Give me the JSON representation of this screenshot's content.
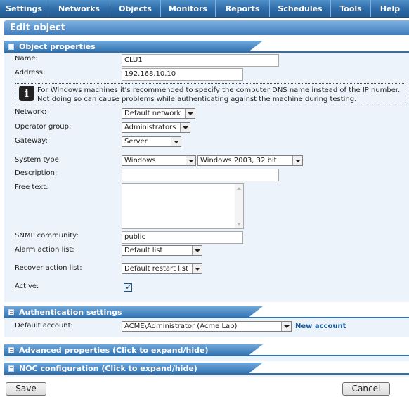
{
  "nav": {
    "items": [
      "Settings",
      "Networks",
      "Objects",
      "Monitors",
      "Reports",
      "Schedules",
      "Tools",
      "Help"
    ]
  },
  "page_title": "Edit object",
  "sections": {
    "object_properties": "Object properties",
    "authentication": "Authentication settings",
    "advanced": "Advanced properties (Click to expand/hide)",
    "noc": "NOC configuration (Click to expand/hide)"
  },
  "form": {
    "name_label": "Name:",
    "name_value": "CLU1",
    "address_label": "Address:",
    "address_value": "192.168.10.10",
    "info_text": "For Windows machines it's recommended to specify the computer DNS name instead of the IP number. Not doing so can cause problems while authenticating against the machine during testing.",
    "network_label": "Network:",
    "network_value": "Default network",
    "operator_group_label": "Operator group:",
    "operator_group_value": "Administrators",
    "gateway_label": "Gateway:",
    "gateway_value": "Server",
    "system_type_label": "System type:",
    "system_type_value": "Windows",
    "system_version_value": "Windows 2003, 32 bit",
    "description_label": "Description:",
    "description_value": "",
    "free_text_label": "Free text:",
    "free_text_value": "",
    "snmp_label": "SNMP community:",
    "snmp_value": "public",
    "alarm_label": "Alarm action list:",
    "alarm_value": "Default list",
    "recover_label": "Recover action list:",
    "recover_value": "Default restart list",
    "active_label": "Active:",
    "active_checked": true
  },
  "auth": {
    "default_account_label": "Default account:",
    "default_account_value": "ACME\\Administrator (Acme Lab)",
    "new_account_link": "New account"
  },
  "buttons": {
    "save": "Save",
    "cancel": "Cancel"
  }
}
